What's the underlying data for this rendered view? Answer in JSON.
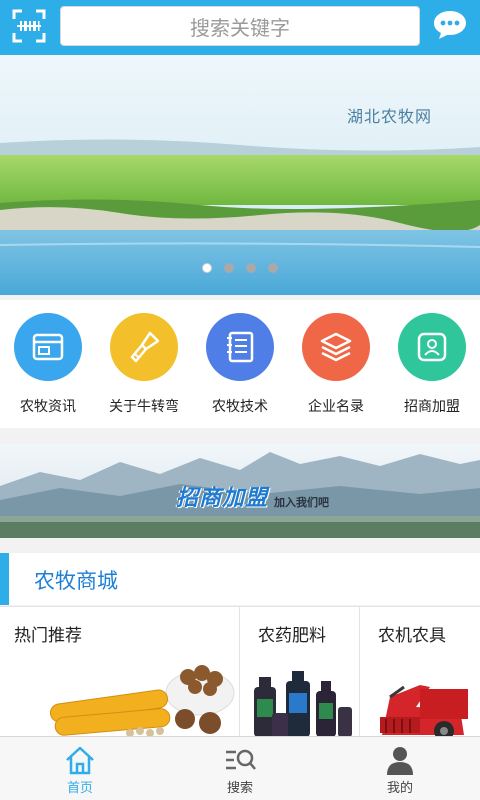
{
  "header": {
    "search_placeholder": "搜索关键字"
  },
  "banner": {
    "text": "湖北农牧网",
    "slide_count": 4,
    "active_slide": 1
  },
  "categories": [
    {
      "label": "农牧资讯",
      "color": "#3aa6ee",
      "icon": "document-window-icon"
    },
    {
      "label": "关于牛转弯",
      "color": "#f3c02c",
      "icon": "broom-icon"
    },
    {
      "label": "农牧技术",
      "color": "#4f7fe6",
      "icon": "notebook-icon"
    },
    {
      "label": "企业名录",
      "color": "#f06748",
      "icon": "layers-icon"
    },
    {
      "label": "招商加盟",
      "color": "#2ec69a",
      "icon": "person-icon"
    }
  ],
  "join_banner": {
    "title": "招商加盟",
    "subtitle": "加入我们吧"
  },
  "section": {
    "title": "农牧商城"
  },
  "products": [
    {
      "label": "热门推荐"
    },
    {
      "label": "农药肥料"
    },
    {
      "label": "农机农具"
    }
  ],
  "bottom_nav": [
    {
      "label": "首页",
      "active": true
    },
    {
      "label": "搜索",
      "active": false
    },
    {
      "label": "我的",
      "active": false
    }
  ],
  "colors": {
    "primary": "#2eaee8",
    "section_title": "#1e7fd4"
  }
}
